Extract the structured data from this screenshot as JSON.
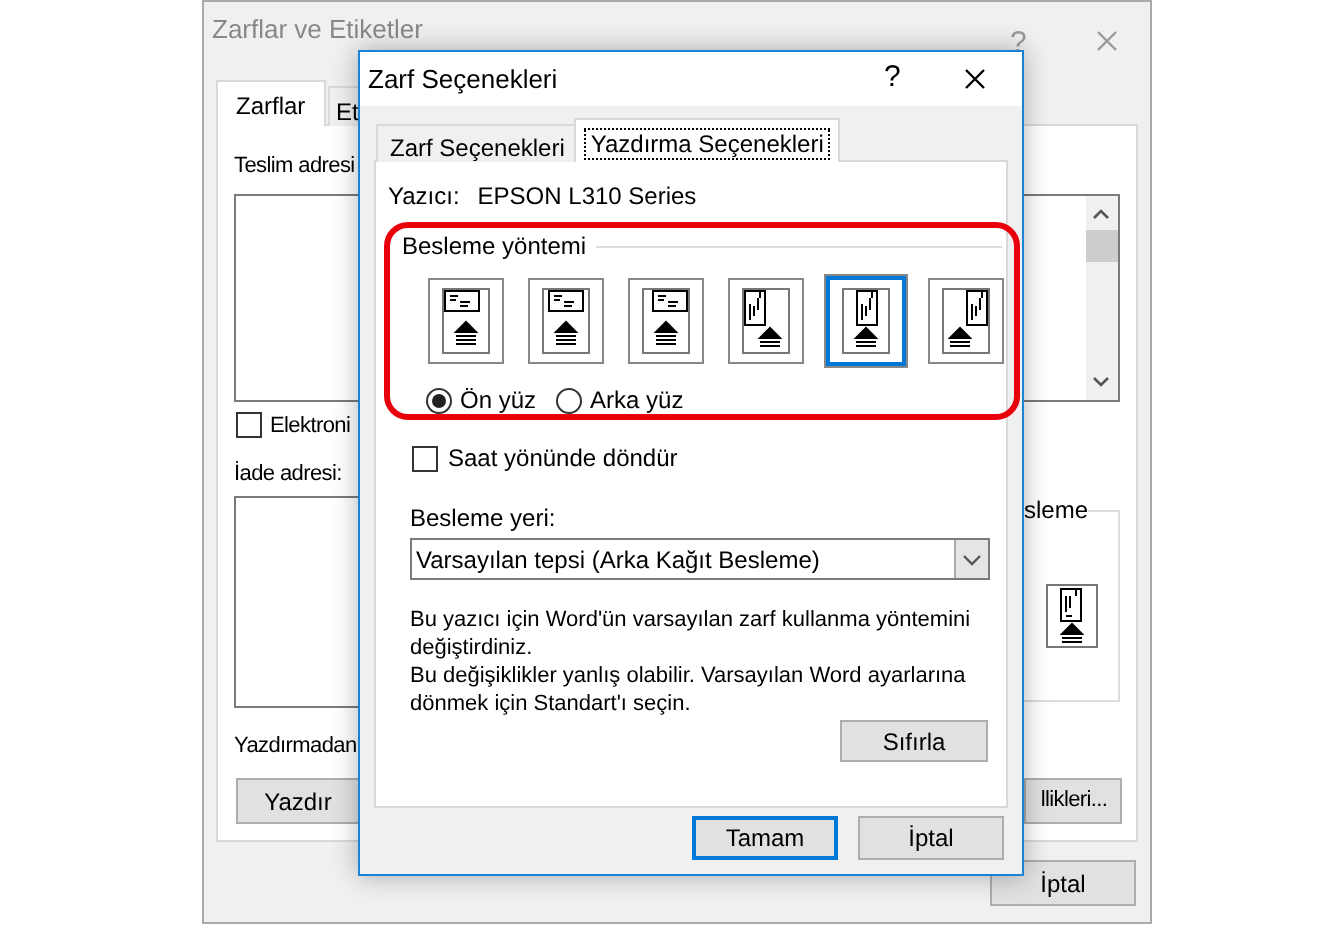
{
  "background_window": {
    "title": "Zarflar ve Etiketler",
    "help": "?",
    "tabs": [
      {
        "label": "Zarflar",
        "selected": true
      },
      {
        "label": "Et",
        "selected": false
      }
    ],
    "delivery_label": "Teslim adresi",
    "electronic_checkbox": {
      "label": "Elektroni",
      "checked": false
    },
    "return_label": "İade adresi:",
    "preview_text": "Yazdırmadan",
    "print_button": "Yazdır",
    "feed_label": "sleme",
    "properties_button": "llikleri...",
    "cancel_button": "İptal"
  },
  "dialog": {
    "title": "Zarf Seçenekleri",
    "help": "?",
    "tabs": [
      {
        "label": "Zarf Seçenekleri",
        "selected": false
      },
      {
        "label": "Yazdırma Seçenekleri",
        "selected": true
      }
    ],
    "printer_label": "Yazıcı:",
    "printer_name": "EPSON L310 Series",
    "feed_method": {
      "title": "Besleme yöntemi",
      "options": [
        {
          "kind": "landscape-left",
          "selected": false
        },
        {
          "kind": "landscape-center",
          "selected": false
        },
        {
          "kind": "landscape-right",
          "selected": false
        },
        {
          "kind": "portrait-left",
          "selected": false
        },
        {
          "kind": "portrait-center",
          "selected": true
        },
        {
          "kind": "portrait-right",
          "selected": false
        }
      ],
      "faces": [
        {
          "label": "Ön yüz",
          "selected": true
        },
        {
          "label": "Arka yüz",
          "selected": false
        }
      ]
    },
    "rotate_checkbox": {
      "label": "Saat yönünde döndür",
      "checked": false
    },
    "feed_source": {
      "label": "Besleme yeri:",
      "value": "Varsayılan tepsi (Arka Kağıt Besleme)"
    },
    "notes": [
      "Bu yazıcı için Word'ün varsayılan zarf kullanma yöntemini değiştirdiniz.",
      "Bu değişiklikler yanlış olabilir. Varsayılan Word ayarlarına dönmek için Standart'ı seçin."
    ],
    "reset_button": "Sıfırla",
    "ok_button": "Tamam",
    "cancel_button": "İptal"
  }
}
